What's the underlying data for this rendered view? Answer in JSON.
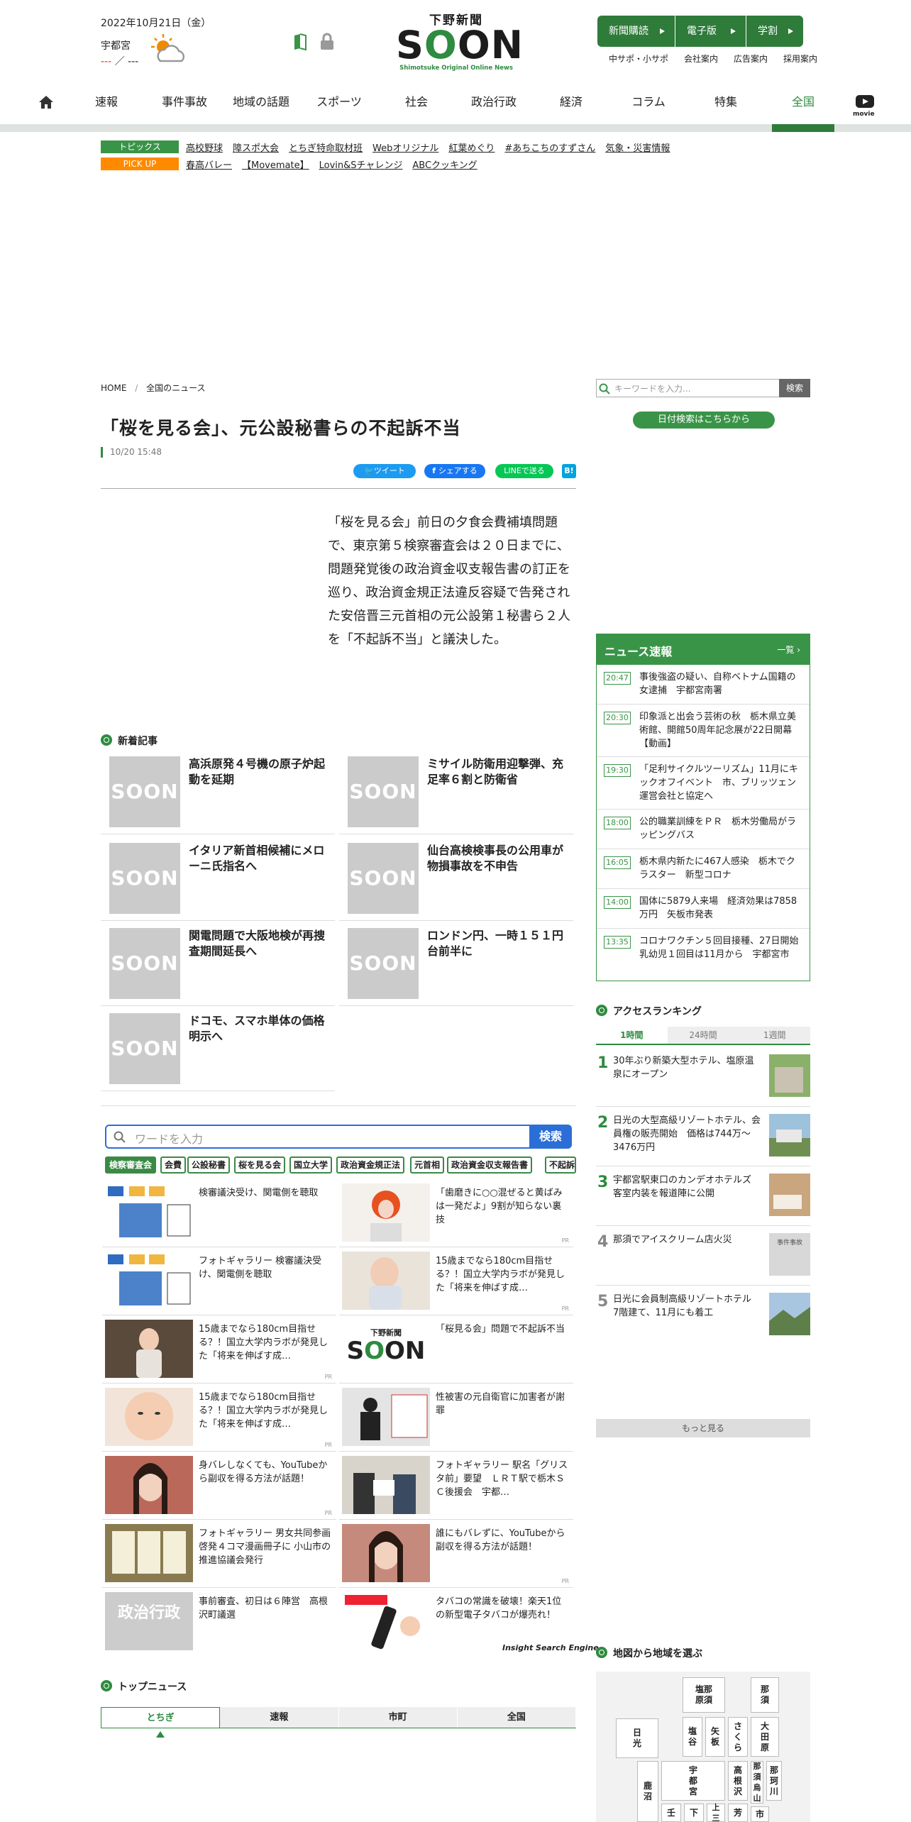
{
  "header": {
    "date": "2022年10月21日（金）",
    "city": "宇都宮",
    "temp_hi": "---",
    "temp_sep": "／",
    "temp_lo": "---",
    "logo_top": "下野新聞",
    "logo_big": "SOON",
    "logo_sub": "Shimotsuke Original Online News",
    "buttons": [
      "新聞購読",
      "電子版",
      "学割"
    ],
    "sublinks": [
      "中サポ・小サポ",
      "会社案内",
      "広告案内",
      "採用案内"
    ]
  },
  "nav": {
    "items": [
      "速報",
      "事件事故",
      "地域の話題",
      "スポーツ",
      "社会",
      "政治行政",
      "経済",
      "コラム",
      "特集",
      "全国"
    ],
    "movie": "movie"
  },
  "topics": {
    "tag1": "トピックス",
    "links1": [
      "高校野球",
      "障スポ大会",
      "とちぎ特命取材班",
      "Webオリジナル",
      "紅葉めぐり",
      "#あちこちのすずさん",
      "気象・災害情報"
    ],
    "tag2": "PICK UP",
    "links2": [
      "春高バレー",
      "【Movemate】",
      "Lovin&Sチャレンジ",
      "ABCクッキング"
    ]
  },
  "breadcrumb": {
    "home": "HOME",
    "sep": "/",
    "current": "全国のニュース"
  },
  "article": {
    "title": "「桜を見る会」、元公設秘書らの不起訴不当",
    "time": "10/20 15:48",
    "share": [
      "ツイート",
      "シェアする",
      "LINEで送る",
      "B!"
    ],
    "body": "「桜を見る会」前日の夕食会費補填問題で、東京第５検察審査会は２０日までに、問題発覚後の政治資金収支報告書の訂正を巡り、政治資金規正法違反容疑で告発された安倍晋三元首相の元公設第１秘書ら２人を「不起訴不当」と議決した。"
  },
  "new_articles": {
    "heading": "新着記事",
    "thumb": "SOON",
    "items": [
      "高浜原発４号機の原子炉起動を延期",
      "ミサイル防衛用迎撃弾、充足率６割と防衛省",
      "イタリア新首相候補にメローニ氏指名へ",
      "仙台高検検事長の公用車が物損事故を不申告",
      "関電問題で大阪地検が再捜査期間延長へ",
      "ロンドン円、一時１５１円台前半に",
      "ドコモ、スマホ単体の価格明示へ"
    ]
  },
  "search_engine": {
    "placeholder": "ワードを入力",
    "button": "検索",
    "keywords": [
      "検察審査会",
      "会費",
      "公設秘書",
      "桜を見る会",
      "国立大学",
      "政治資金規正法",
      "元首相",
      "政治資金収支報告書",
      "不起訴"
    ],
    "items": [
      {
        "text": "検審議決受け、関電側を聴取",
        "pr": ""
      },
      {
        "text": "「歯磨きに○○混ぜると黄ばみは一発だよ」9割が知らない裏技",
        "pr": "PR"
      },
      {
        "text": "フォトギャラリー 検審議決受け、関電側を聴取",
        "pr": ""
      },
      {
        "text": "15歳までなら180cm目指せる？！国立大学内ラボが発見した「将来を伸ばす成…",
        "pr": "PR"
      },
      {
        "text": "15歳までなら180cm目指せる？！国立大学内ラボが発見した「将来を伸ばす成…",
        "pr": "PR"
      },
      {
        "text": "「桜見る会」問題で不起訴不当",
        "pr": ""
      },
      {
        "text": "15歳までなら180cm目指せる？！国立大学内ラボが発見した「将来を伸ばす成…",
        "pr": "PR"
      },
      {
        "text": "性被害の元自衛官に加害者が謝罪",
        "pr": ""
      },
      {
        "text": "身バレしなくても、YouTubeから副収を得る方法が話題！",
        "pr": "PR"
      },
      {
        "text": "フォトギャラリー 駅名「グリスタ前」要望　ＬＲＴ駅で栃木ＳＣ後援会　宇都…",
        "pr": ""
      },
      {
        "text": "フォトギャラリー 男女共同参画 啓発４コマ漫画冊子に 小山市の推進協議会発行",
        "pr": ""
      },
      {
        "text": "誰にもバレずに、YouTubeから副収を得る方法が話題！",
        "pr": "PR"
      },
      {
        "text": "事前審査、初日は６陣営　高根沢町議選",
        "pr": ""
      },
      {
        "text": "タバコの常識を破壊！楽天1位の新型電子タバコが爆売れ！",
        "pr": ""
      }
    ],
    "thumb_label_politics": "政治行政",
    "footer": "Insight Search Engine"
  },
  "top_news": {
    "heading": "トップニュース",
    "tabs": [
      "とちぎ",
      "速報",
      "市町",
      "全国"
    ]
  },
  "sidebar": {
    "search_placeholder": "キーワードを入力...",
    "search_button": "検索",
    "date_search": "日付検索はこちらから",
    "flash": {
      "title": "ニュース速報",
      "more": "一覧 ›",
      "items": [
        {
          "time": "20:47",
          "text": "事後強盗の疑い、自称ベトナム国籍の女逮捕　宇都宮南署"
        },
        {
          "time": "20:30",
          "text": "印象派と出会う芸術の秋　栃木県立美術館、開館50周年記念展が22日開幕【動画】"
        },
        {
          "time": "19:30",
          "text": "「足利サイクルツーリズム」11月にキックオフイベント　市、ブリッツェン運営会社と協定へ"
        },
        {
          "time": "18:00",
          "text": "公的職業訓練をＰＲ　栃木労働局がラッピングバス"
        },
        {
          "time": "16:05",
          "text": "栃木県内新たに467人感染　栃木でクラスター　新型コロナ"
        },
        {
          "time": "14:00",
          "text": "国体に5879人来場　経済効果は7858万円　矢板市発表"
        },
        {
          "time": "13:35",
          "text": "コロナワクチン５回目接種、27日開始　乳幼児１回目は11月から　宇都宮市"
        }
      ]
    },
    "ranking": {
      "heading": "アクセスランキング",
      "tabs": [
        "1時間",
        "24時間",
        "1週間"
      ],
      "items": [
        {
          "rank": "1",
          "text": "30年ぶり新築大型ホテル、塩原温泉にオープン"
        },
        {
          "rank": "2",
          "text": "日光の大型高級リゾートホテル、会員権の販売開始　価格は744万～3476万円"
        },
        {
          "rank": "3",
          "text": "宇都宮駅東口のカンデオホテルズ　客室内装を報道陣に公開"
        },
        {
          "rank": "4",
          "text": "那須でアイスクリーム店火災",
          "thumb": "事件事故"
        },
        {
          "rank": "5",
          "text": "日光に会員制高級リゾートホテル　7階建て、11月にも着工"
        }
      ],
      "more": "もっと見る"
    },
    "map": {
      "heading": "地図から地域を選ぶ",
      "cells": [
        "塩那\n原須",
        "那\n須",
        "日\n光",
        "塩\n谷",
        "矢\n板",
        "さ\nく\nら",
        "大\n田\n原",
        "宇\n都\n宮",
        "高\n根\n沢",
        "那\n須\n烏\n山",
        "那\n珂\n川",
        "鹿\n沼",
        "壬",
        "下",
        "上\n三",
        "芳",
        "市"
      ]
    }
  },
  "colors": {
    "brand_green": "#2e8b40",
    "nav_green": "#2e7b3a",
    "search_blue": "#2b6fd6",
    "pickup_orange": "#ff8a00"
  }
}
